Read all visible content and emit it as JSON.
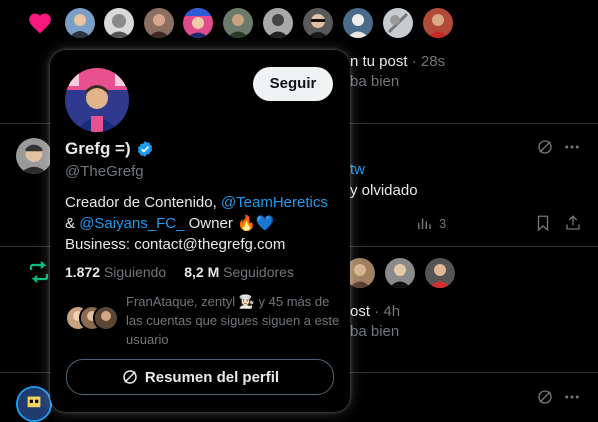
{
  "notif1": {
    "suffix": "n tu post",
    "time": "· 28s",
    "preview": "ba bien"
  },
  "tweet": {
    "link_fragment": "tw",
    "text_fragment": "y olvidado",
    "views": "3"
  },
  "notif2": {
    "suffix": "ost",
    "time": "· 4h",
    "preview": "ba bien"
  },
  "hovercard": {
    "follow_label": "Seguir",
    "name": "Grefg =)",
    "handle": "@TheGrefg",
    "bio_line1_text": "Creador de Contenido, ",
    "bio_line1_link": "@TeamHeretics",
    "bio_line2_prefix": "& ",
    "bio_line2_link": "@Saiyans_FC_",
    "bio_line2_suffix": " Owner 🔥💙",
    "bio_line3": "Business: contact@thegrefg.com",
    "following_count": "1.872",
    "following_label": "Siguiendo",
    "followers_count": "8,2 M",
    "followers_label": "Seguidores",
    "followers_you_know": "FranAtaque, zentyl 👩🏻‍🍳 y 45 más de las cuentas que sigues siguen a este usuario",
    "summary_label": "Resumen del perfil"
  },
  "colors": {
    "accent": "#1d9bf0",
    "like": "#f91880",
    "retweet": "#00ba7c",
    "muted": "#71767b",
    "divider": "#2f3336"
  },
  "icons": {
    "like": "heart-icon",
    "retweet": "retweet-icon",
    "verified": "verified-icon",
    "grok": "grok-icon",
    "more": "more-icon",
    "views": "views-icon",
    "bookmark": "bookmark-icon",
    "share": "share-icon"
  }
}
